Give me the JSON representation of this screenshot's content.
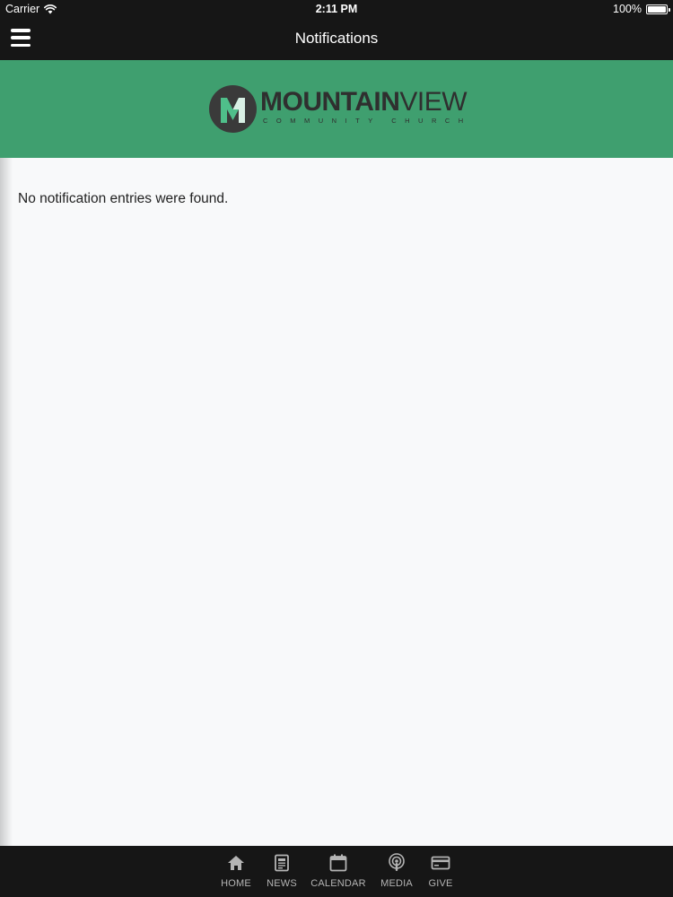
{
  "status_bar": {
    "carrier": "Carrier",
    "time": "2:11 PM",
    "battery": "100%"
  },
  "nav": {
    "title": "Notifications"
  },
  "logo": {
    "word_bold": "MOUNTAIN",
    "word_light": "VIEW",
    "subtitle": "COMMUNITY CHURCH",
    "mark_letter": "M"
  },
  "content": {
    "empty_message": "No notification entries were found."
  },
  "tabs": [
    {
      "label": "HOME",
      "icon": "home-icon"
    },
    {
      "label": "NEWS",
      "icon": "news-icon"
    },
    {
      "label": "CALENDAR",
      "icon": "calendar-icon"
    },
    {
      "label": "MEDIA",
      "icon": "podcast-icon"
    },
    {
      "label": "GIVE",
      "icon": "credit-card-icon"
    }
  ],
  "colors": {
    "topbar": "#161616",
    "banner": "#3f9f6f",
    "background": "#f8f9fa",
    "tab_text": "#b4b4b4",
    "logo_dark": "#2f2f2f"
  }
}
